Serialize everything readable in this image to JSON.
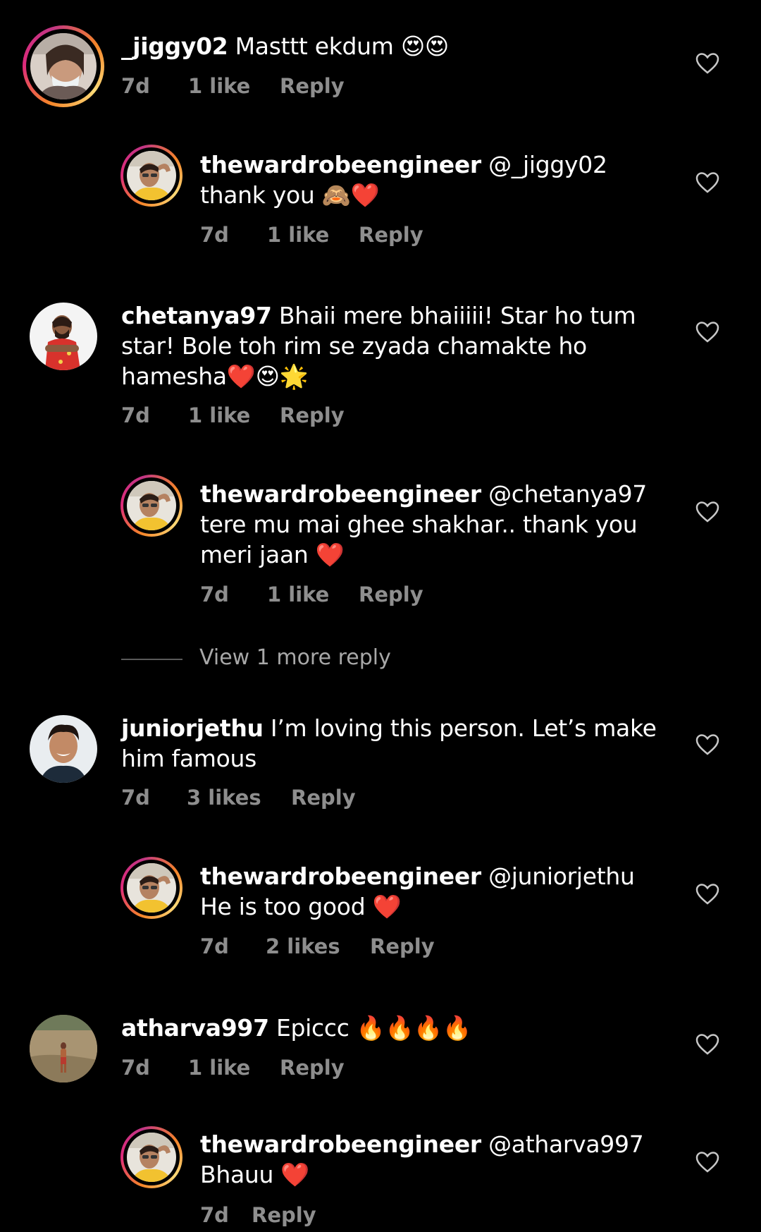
{
  "comments": [
    {
      "username": "_jiggy02",
      "text": "Masttt ekdum 😍😍",
      "time": "7d",
      "likes": "1 like",
      "reply": "Reply",
      "is_reply": false
    },
    {
      "username": "thewardrobeengineer",
      "text": "@_jiggy02 thank you 🙈❤️",
      "time": "7d",
      "likes": "1 like",
      "reply": "Reply",
      "is_reply": true
    },
    {
      "username": "chetanya97",
      "text": "Bhaii mere bhaiiiii! Star ho tum star! Bole toh rim se zyada chamakte ho hamesha❤️😍🌟",
      "time": "7d",
      "likes": "1 like",
      "reply": "Reply",
      "is_reply": false
    },
    {
      "username": "thewardrobeengineer",
      "text": "@chetanya97 tere mu mai ghee shakhar.. thank you meri jaan ❤️",
      "time": "7d",
      "likes": "1 like",
      "reply": "Reply",
      "is_reply": true
    },
    {
      "username": "juniorjethu",
      "text": "I’m loving this person. Let’s make him famous",
      "time": "7d",
      "likes": "3 likes",
      "reply": "Reply",
      "is_reply": false
    },
    {
      "username": "thewardrobeengineer",
      "text": "@juniorjethu He is too good ❤️",
      "time": "7d",
      "likes": "2 likes",
      "reply": "Reply",
      "is_reply": true
    },
    {
      "username": "atharva997",
      "text": "Epiccc 🔥🔥🔥🔥",
      "time": "7d",
      "likes": "1 like",
      "reply": "Reply",
      "is_reply": false
    },
    {
      "username": "thewardrobeengineer",
      "text": "@atharva997 Bhauu ❤️",
      "time": "7d",
      "likes": "",
      "reply": "Reply",
      "is_reply": true
    }
  ],
  "view_more_replies": "View 1 more reply",
  "colors": {
    "background": "#000000",
    "primary_text": "#ffffff",
    "meta_text": "#8e8e8e",
    "story_ring": "#dd2a7b"
  },
  "icons": {
    "like": "heart-outline-icon"
  }
}
